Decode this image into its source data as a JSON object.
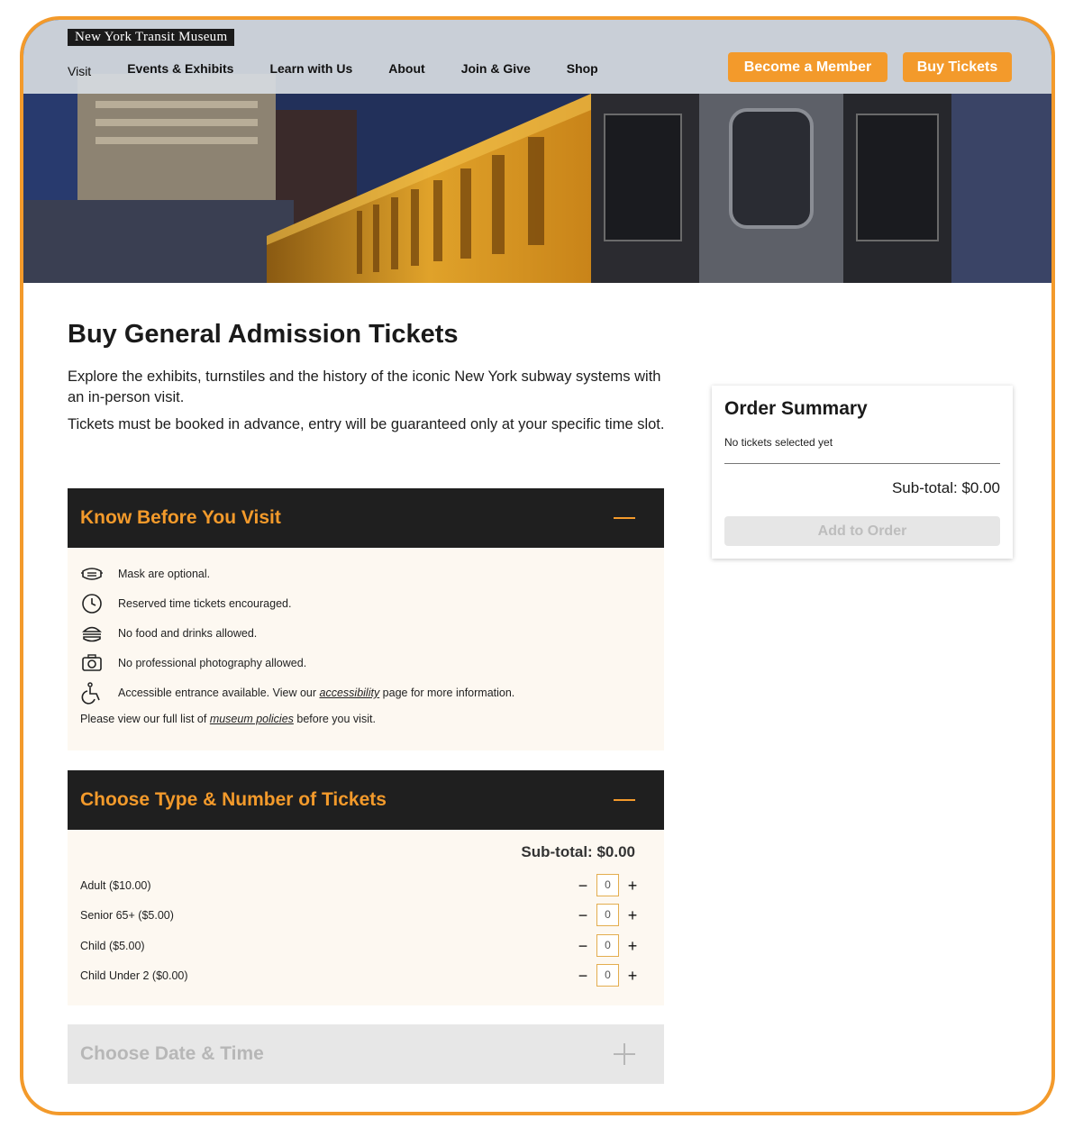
{
  "header": {
    "logo_text": "New York Transit Museum",
    "nav": [
      "Visit",
      "Events & Exhibits",
      "Learn with Us",
      "About",
      "Join & Give",
      "Shop"
    ],
    "member_button": "Become a Member",
    "buy_button": "Buy Tickets"
  },
  "main": {
    "title": "Buy General Admission Tickets",
    "intro_1": "Explore the exhibits, turnstiles and the history of the iconic New York subway systems with an in-person visit.",
    "intro_2": "Tickets must be booked in advance, entry will be guaranteed only at your specific time slot."
  },
  "know_before": {
    "title": "Know Before You Visit",
    "items": [
      {
        "icon": "mask-icon",
        "text": "Mask are optional."
      },
      {
        "icon": "clock-icon",
        "text": "Reserved time tickets encouraged."
      },
      {
        "icon": "burger-icon",
        "text": "No food and drinks allowed."
      },
      {
        "icon": "camera-icon",
        "text": "No professional photography allowed."
      },
      {
        "icon": "wheelchair-icon",
        "text_before": "Accessible entrance available. View our ",
        "link": "accessibility",
        "text_after": " page for more information."
      }
    ],
    "policy_before": "Please view our full list of ",
    "policy_link": "museum policies",
    "policy_after": " before you visit."
  },
  "tickets": {
    "title": "Choose Type & Number of Tickets",
    "subtotal": "Sub-total: $0.00",
    "rows": [
      {
        "label": "Adult ($10.00)",
        "qty": "0"
      },
      {
        "label": "Senior 65+ ($5.00)",
        "qty": "0"
      },
      {
        "label": "Child ($5.00)",
        "qty": "0"
      },
      {
        "label": "Child Under 2 ($0.00)",
        "qty": "0"
      }
    ],
    "minus": "−",
    "plus": "+"
  },
  "date_time": {
    "title": "Choose Date & Time"
  },
  "summary": {
    "title": "Order Summary",
    "empty": "No tickets selected yet",
    "subtotal": "Sub-total: $0.00",
    "button": "Add to Order"
  },
  "colors": {
    "accent": "#f39a2b",
    "dark": "#1f1f1f",
    "panel": "#fdf8f1"
  }
}
